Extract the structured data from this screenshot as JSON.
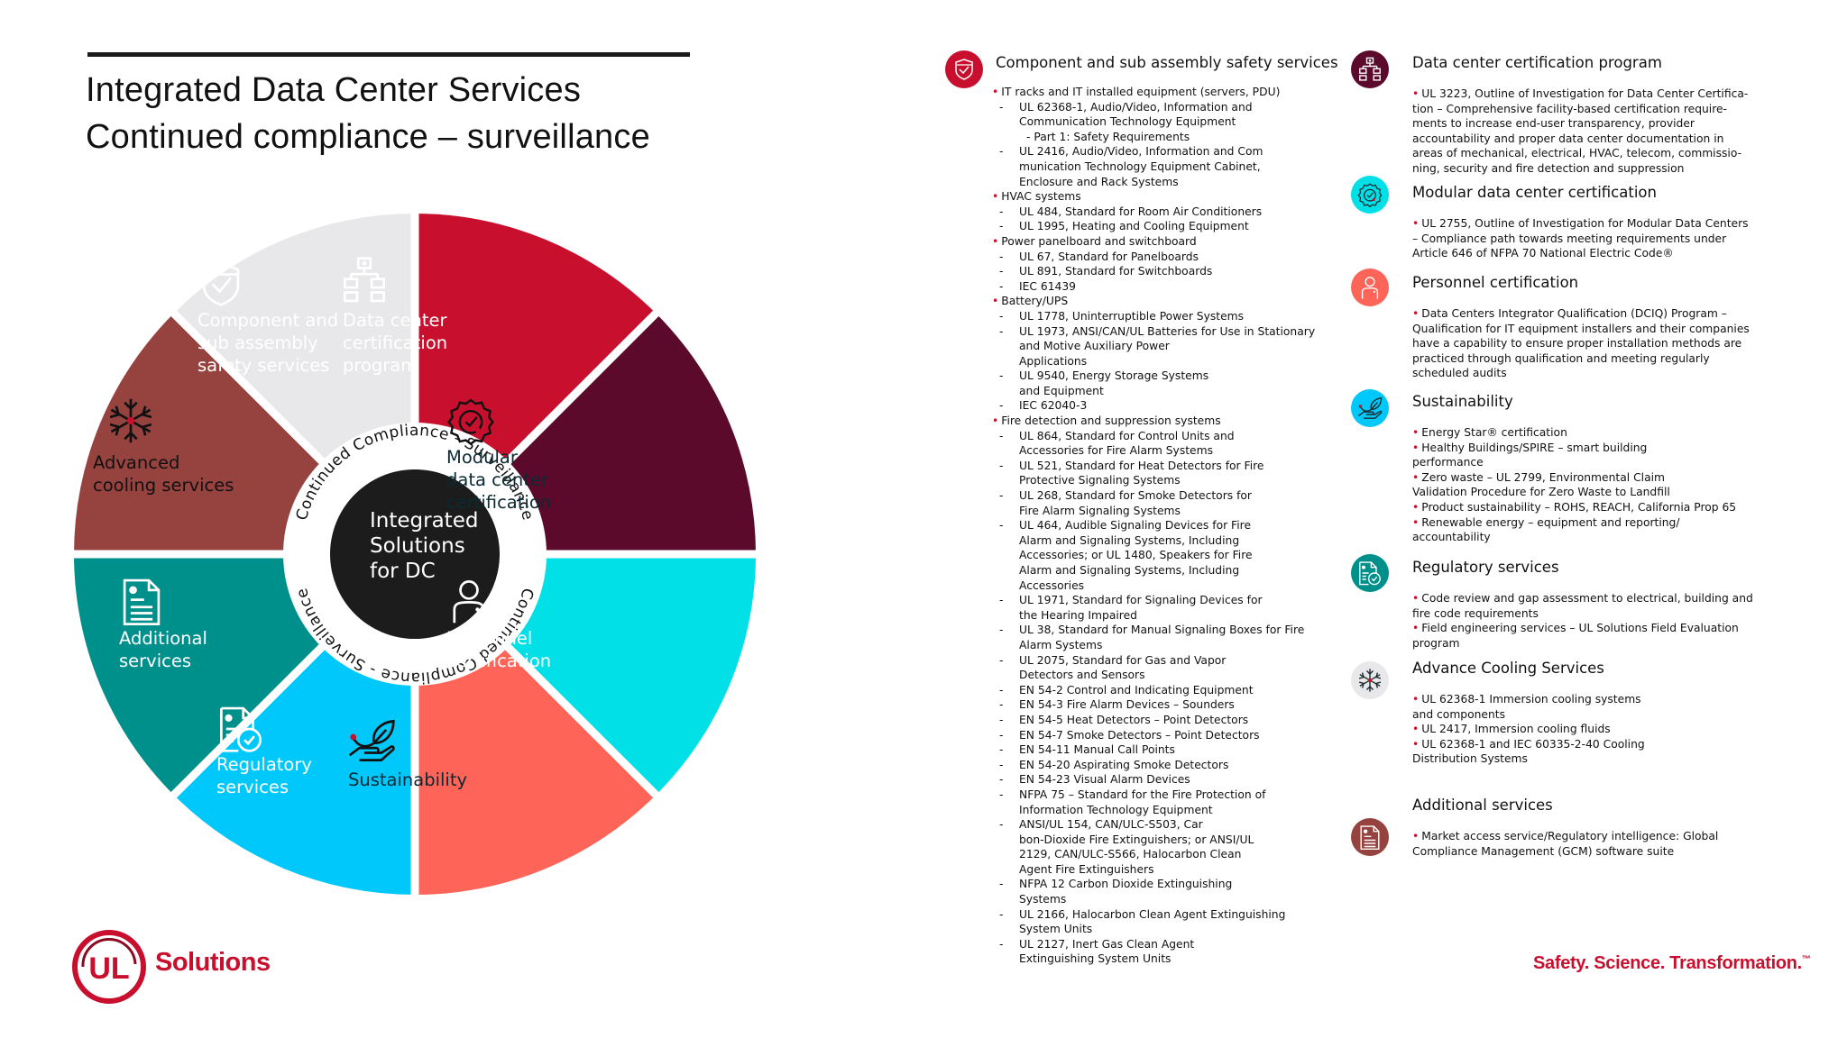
{
  "header": {
    "title_line1": "Integrated Data Center Services",
    "title_line2": "Continued compliance – surveillance"
  },
  "wheel": {
    "center_label": [
      "Integrated",
      "Solutions",
      "for DC"
    ],
    "ring_text_top": "Continued Compliance - Surveillance",
    "ring_text_bottom": "Continued Compliance - Surveillance",
    "segments": [
      {
        "id": "component",
        "icon": "shield-check-icon",
        "label": [
          "Component and",
          "sub assembly",
          "safety services"
        ],
        "color": "#c8102e",
        "text_color": "#ffffff"
      },
      {
        "id": "datacenter",
        "icon": "org-chart-icon",
        "label": [
          "Data center",
          "certification",
          "program"
        ],
        "color": "#5c0a2b",
        "text_color": "#ffffff"
      },
      {
        "id": "modular",
        "icon": "badge-check-icon",
        "label": [
          "Modular",
          "data center",
          "certification"
        ],
        "color": "#00e0e6",
        "text_color": "#0a2a33"
      },
      {
        "id": "personnel",
        "icon": "person-icon",
        "label": [
          "Personnel",
          "certification"
        ],
        "color": "#ff6459",
        "text_color": "#ffffff"
      },
      {
        "id": "sustainability",
        "icon": "leaf-hand-icon",
        "label": [
          "Sustainability"
        ],
        "color": "#00c8fa",
        "text_color": "#0a2a33"
      },
      {
        "id": "regulatory",
        "icon": "document-check-icon",
        "label": [
          "Regulatory",
          "services"
        ],
        "color": "#00908c",
        "text_color": "#ffffff"
      },
      {
        "id": "additional",
        "icon": "document-icon",
        "label": [
          "Additional",
          "services"
        ],
        "color": "#964340",
        "text_color": "#ffffff"
      },
      {
        "id": "cooling",
        "icon": "snowflake-icon",
        "label": [
          "Advanced",
          "cooling services"
        ],
        "color": "#e8e8ea",
        "text_color": "#111111"
      }
    ]
  },
  "sections": {
    "component": {
      "title": "Component and sub assembly safety services",
      "groups": [
        {
          "heading": "IT racks and IT installed equipment (servers, PDU)",
          "items": [
            [
              "UL 62368-1, Audio/Video, Information and",
              "Communication Technology Equipment",
              "  - Part 1: Safety Requirements"
            ],
            [
              "UL 2416, Audio/Video, Information and Com",
              "munication Technology Equipment Cabinet,",
              "Enclosure and Rack Systems"
            ]
          ]
        },
        {
          "heading": "HVAC systems",
          "items": [
            [
              "UL 484, Standard for Room Air Conditioners"
            ],
            [
              "UL 1995, Heating and Cooling Equipment"
            ]
          ]
        },
        {
          "heading": "Power panelboard and switchboard",
          "items": [
            [
              "UL 67, Standard for Panelboards"
            ],
            [
              "UL 891, Standard for Switchboards"
            ],
            [
              "IEC 61439"
            ]
          ]
        },
        {
          "heading": "Battery/UPS",
          "items": [
            [
              "UL 1778, Uninterruptible Power Systems"
            ],
            [
              "UL 1973, ANSI/CAN/UL Batteries for Use in Stationary",
              "and Motive Auxiliary Power",
              "Applications"
            ],
            [
              "UL 9540, Energy Storage Systems",
              "and Equipment"
            ],
            [
              "IEC 62040-3"
            ]
          ]
        },
        {
          "heading": "Fire detection and suppression systems",
          "items": [
            [
              "UL 864, Standard for Control Units and",
              "Accessories for Fire Alarm Systems"
            ],
            [
              "UL 521, Standard for Heat Detectors for Fire",
              "Protective Signaling Systems"
            ],
            [
              "UL 268, Standard for Smoke Detectors for",
              "Fire Alarm Signaling Systems"
            ],
            [
              "UL 464, Audible Signaling Devices for Fire",
              "Alarm and Signaling Systems, Including",
              "Accessories; or UL 1480, Speakers for Fire",
              "Alarm and Signaling Systems, Including",
              "Accessories"
            ],
            [
              "UL 1971, Standard for Signaling Devices for",
              "the Hearing Impaired"
            ],
            [
              "UL 38, Standard for Manual Signaling Boxes for Fire",
              "Alarm Systems"
            ],
            [
              "UL 2075, Standard for Gas and Vapor",
              "Detectors and Sensors"
            ],
            [
              "EN 54-2 Control and Indicating Equipment"
            ],
            [
              "EN 54-3 Fire Alarm Devices – Sounders"
            ],
            [
              "EN 54-5 Heat Detectors – Point Detectors"
            ],
            [
              "EN 54-7 Smoke Detectors – Point Detectors"
            ],
            [
              "EN 54-11 Manual Call Points"
            ],
            [
              "EN 54-20 Aspirating Smoke Detectors"
            ],
            [
              "EN 54-23 Visual Alarm Devices"
            ],
            [
              "NFPA 75 – Standard for the Fire Protection  of",
              "Information Technology Equipment"
            ],
            [
              "ANSI/UL 154, CAN/ULC-S503, Car",
              "bon-Dioxide Fire Extinguishers; or ANSI/UL",
              "2129, CAN/ULC-S566, Halocarbon Clean",
              "Agent Fire Extinguishers"
            ],
            [
              "NFPA 12 Carbon Dioxide Extinguishing",
              "Systems"
            ],
            [
              "UL 2166, Halocarbon Clean Agent Extinguishing",
              "System Units"
            ],
            [
              "UL 2127, Inert Gas Clean Agent",
              "Extinguishing System Units"
            ]
          ]
        }
      ]
    },
    "right": [
      {
        "id": "datacenter",
        "title": "Data center certification program",
        "icon": "org-chart-icon",
        "color": "#5c0a2b",
        "lines": [
          [
            "b",
            "UL 3223, Outline of Investigation for Data Center Certifica-"
          ],
          [
            "c",
            "tion – Comprehensive facility-based certification require-"
          ],
          [
            "c",
            "ments to increase end-user transparency, provider"
          ],
          [
            "c",
            "accountability and proper data center documentation in"
          ],
          [
            "c",
            "areas of mechanical, electrical, HVAC, telecom, commissio-"
          ],
          [
            "c",
            "ning, security and fire detection and suppression"
          ]
        ]
      },
      {
        "id": "modular",
        "title": "Modular data center certification",
        "icon": "badge-check-icon",
        "color": "#00e0e6",
        "lines": [
          [
            "b",
            "UL 2755, Outline of Investigation for Modular Data Centers"
          ],
          [
            "c",
            "– Compliance path towards meeting requirements under"
          ],
          [
            "c",
            "Article 646 of NFPA 70 National Electric Code®"
          ]
        ]
      },
      {
        "id": "personnel",
        "title": "Personnel certification",
        "icon": "person-icon",
        "color": "#ff6459",
        "lines": [
          [
            "b",
            "Data Centers Integrator Qualification (DCIQ) Program –"
          ],
          [
            "c",
            "Qualification for IT equipment installers and their companies"
          ],
          [
            "c",
            "have a capability to ensure proper installation methods are"
          ],
          [
            "c",
            "practiced through qualification and meeting regularly"
          ],
          [
            "c",
            "scheduled audits"
          ]
        ]
      },
      {
        "id": "sustainability",
        "title": "Sustainability",
        "icon": "leaf-hand-icon",
        "color": "#00c8fa",
        "lines": [
          [
            "b",
            "Energy Star® certification"
          ],
          [
            "b",
            "Healthy Buildings/SPIRE – smart building"
          ],
          [
            "c",
            "performance"
          ],
          [
            "b",
            "Zero waste – UL 2799, Environmental Claim"
          ],
          [
            "c",
            "Validation Procedure for Zero Waste to Landfill"
          ],
          [
            "b",
            "Product sustainability – ROHS, REACH, California Prop 65"
          ],
          [
            "b",
            "Renewable energy – equipment and reporting/"
          ],
          [
            "c",
            "accountability"
          ]
        ]
      },
      {
        "id": "regulatory",
        "title": "Regulatory services",
        "icon": "document-check-icon",
        "color": "#00908c",
        "lines": [
          [
            "b",
            "Code review and gap assessment to electrical, building and"
          ],
          [
            "c",
            "fire code requirements"
          ],
          [
            "b",
            "Field engineering services – UL Solutions Field Evaluation"
          ],
          [
            "c",
            "program"
          ]
        ]
      },
      {
        "id": "cooling",
        "title": "Advance Cooling Services",
        "icon": "snowflake-icon",
        "color": "#e8e8ea",
        "lines": [
          [
            "b",
            "UL 62368-1 Immersion cooling systems"
          ],
          [
            "c",
            "and components"
          ],
          [
            "b",
            "UL 2417, Immersion cooling fluids"
          ],
          [
            "b",
            "UL 62368-1 and IEC 60335-2-40 Cooling"
          ],
          [
            "c",
            " Distribution Systems"
          ]
        ]
      },
      {
        "id": "additional",
        "title": "Additional services",
        "icon": "document-icon",
        "color": "#964340",
        "lines": [
          [
            "b",
            "Market access service/Regulatory intelligence: Global"
          ],
          [
            "c",
            "Compliance Management (GCM) software suite"
          ]
        ]
      }
    ]
  },
  "footer": {
    "logo_mark": "UL",
    "logo_text": "Solutions",
    "tagline": "Safety. Science. Transformation.",
    "tagline_tm": "™"
  },
  "colors": {
    "brand_red": "#c8102e",
    "center_dark": "#1c1c1c"
  }
}
